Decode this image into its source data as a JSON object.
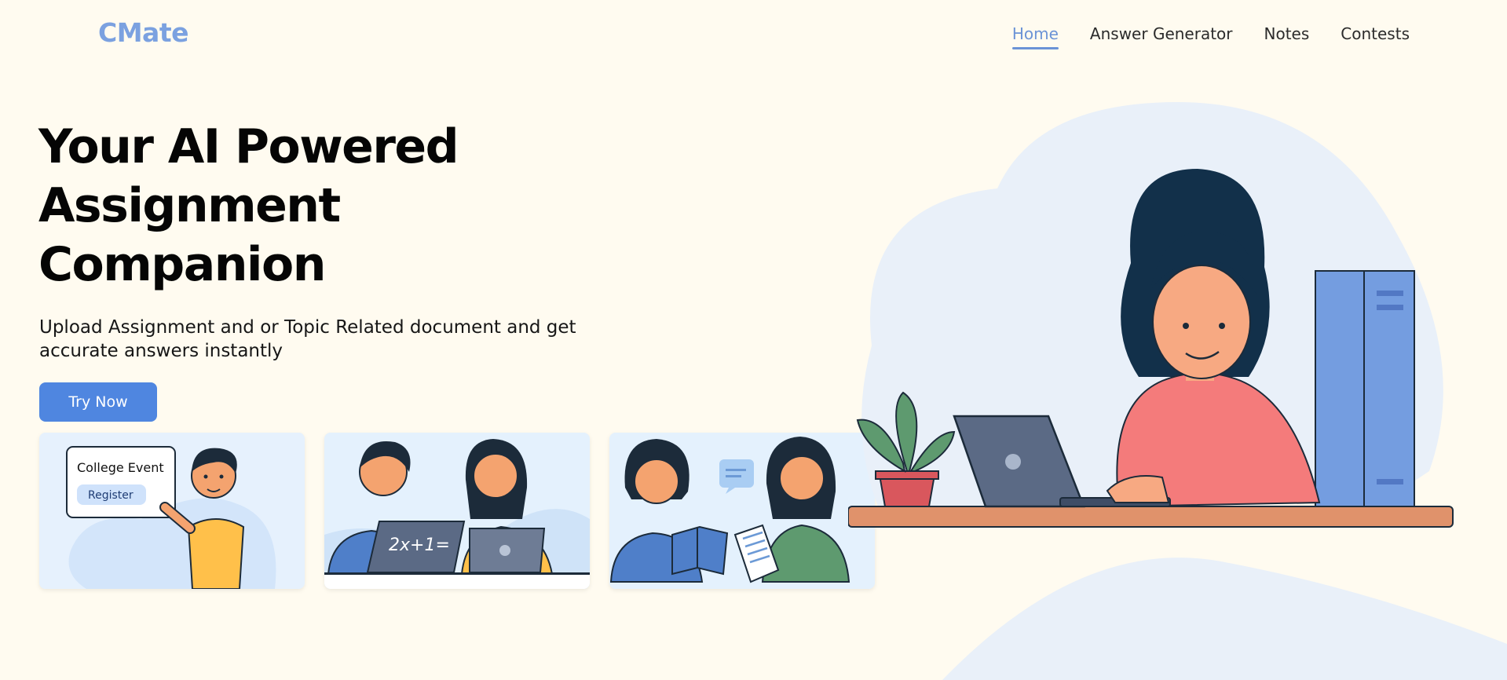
{
  "app": {
    "logo": "CMate"
  },
  "nav": {
    "items": [
      {
        "label": "Home",
        "active": true
      },
      {
        "label": "Answer Generator",
        "active": false
      },
      {
        "label": "Notes",
        "active": false
      },
      {
        "label": "Contests",
        "active": false
      }
    ]
  },
  "hero": {
    "title_line1": "Your AI Powered",
    "title_line2": "Assignment",
    "title_line3": "Companion",
    "subtitle": "Upload Assignment and or Topic Related document and get accurate answers instantly",
    "cta_label": "Try Now"
  },
  "cards": {
    "event_title": "College Event",
    "event_button": "Register",
    "math_text": "2x+1="
  },
  "colors": {
    "background": "#fffbf0",
    "accent": "#4f86e0",
    "logo": "#7ba1e0",
    "blob": "#e9f0f9"
  }
}
